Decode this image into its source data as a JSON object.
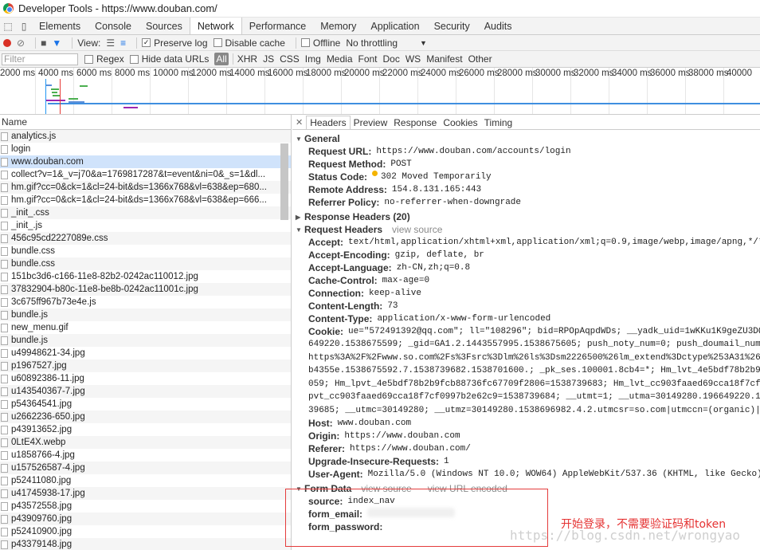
{
  "window": {
    "title": "Developer Tools - https://www.douban.com/"
  },
  "tabs": [
    "Elements",
    "Console",
    "Sources",
    "Network",
    "Performance",
    "Memory",
    "Application",
    "Security",
    "Audits"
  ],
  "toolbar": {
    "view_label": "View:",
    "preserve_log": "Preserve log",
    "disable_cache": "Disable cache",
    "offline": "Offline",
    "throttling": "No throttling"
  },
  "filterbar": {
    "placeholder": "Filter",
    "regex": "Regex",
    "hide_data_urls": "Hide data URLs",
    "types": [
      "All",
      "XHR",
      "JS",
      "CSS",
      "Img",
      "Media",
      "Font",
      "Doc",
      "WS",
      "Manifest",
      "Other"
    ]
  },
  "timeline": {
    "ticks": [
      "2000 ms",
      "4000 ms",
      "6000 ms",
      "8000 ms",
      "10000 ms",
      "12000 ms",
      "14000 ms",
      "16000 ms",
      "18000 ms",
      "20000 ms",
      "22000 ms",
      "24000 ms",
      "26000 ms",
      "28000 ms",
      "30000 ms",
      "32000 ms",
      "34000 ms",
      "36000 ms",
      "38000 ms",
      "40000"
    ]
  },
  "requests": {
    "header": "Name",
    "items": [
      "analytics.js",
      "login",
      "www.douban.com",
      "collect?v=1&_v=j70&a=1769817287&t=event&ni=0&_s=1&dl...",
      "hm.gif?cc=0&ck=1&cl=24-bit&ds=1366x768&vl=638&ep=680...",
      "hm.gif?cc=0&ck=1&cl=24-bit&ds=1366x768&vl=638&ep=666...",
      "_init_.css",
      "_init_.js",
      "456c95cd2227089e.css",
      "bundle.css",
      "bundle.css",
      "151bc3d6-c166-11e8-82b2-0242ac110012.jpg",
      "37832904-b80c-11e8-be8b-0242ac11001c.jpg",
      "3c675ff967b73e4e.js",
      "bundle.js",
      "new_menu.gif",
      "bundle.js",
      "u49948621-34.jpg",
      "p1967527.jpg",
      "u60892386-11.jpg",
      "u143540367-7.jpg",
      "p54364541.jpg",
      "u2662236-650.jpg",
      "p43913652.jpg",
      "0LtE4X.webp",
      "u1858766-4.jpg",
      "u157526587-4.jpg",
      "p52411080.jpg",
      "u41745938-17.jpg",
      "p43572558.jpg",
      "p43909760.jpg",
      "p52410900.jpg",
      "p43379148.jpg"
    ]
  },
  "detail": {
    "tabs": [
      "Headers",
      "Preview",
      "Response",
      "Cookies",
      "Timing"
    ],
    "general": {
      "title": "General",
      "items": [
        {
          "k": "Request URL:",
          "v": "https://www.douban.com/accounts/login"
        },
        {
          "k": "Request Method:",
          "v": "POST"
        },
        {
          "k": "Status Code:",
          "v": "302 Moved Temporarily"
        },
        {
          "k": "Remote Address:",
          "v": "154.8.131.165:443"
        },
        {
          "k": "Referrer Policy:",
          "v": "no-referrer-when-downgrade"
        }
      ]
    },
    "response_headers": {
      "title": "Response Headers (20)"
    },
    "request_headers": {
      "title": "Request Headers",
      "view_source": "view source",
      "items": [
        {
          "k": "Accept:",
          "v": "text/html,application/xhtml+xml,application/xml;q=0.9,image/webp,image/apng,*/*"
        },
        {
          "k": "Accept-Encoding:",
          "v": "gzip, deflate, br"
        },
        {
          "k": "Accept-Language:",
          "v": "zh-CN,zh;q=0.8"
        },
        {
          "k": "Cache-Control:",
          "v": "max-age=0"
        },
        {
          "k": "Connection:",
          "v": "keep-alive"
        },
        {
          "k": "Content-Length:",
          "v": "73"
        },
        {
          "k": "Content-Type:",
          "v": "application/x-www-form-urlencoded"
        }
      ],
      "cookie_key": "Cookie:",
      "cookie_lines": [
        "ue=\"572491392@qq.com\"; ll=\"108296\"; bid=RPOpAqpdWDs; __yadk_uid=1wKKu1K9geZU3DQ",
        "649220.1538675599; _gid=GA1.2.1443557995.1538675605; push_noty_num=0; push_doumail_num",
        "https%3A%2F%2Fwww.so.com%2Fs%3Fsrc%3Dlm%26ls%3Dsm2226500%26lm_extend%3Dctype%253A31%26",
        "b4355e.1538675592.7.1538739682.1538701600.; _pk_ses.100001.8cb4=*; Hm_lvt_4e5bdf78b2b9",
        "059; Hm_lpvt_4e5bdf78b2b9fcb88736fc67709f2806=1538739683; Hm_lvt_cc903faaed69cca18f7cf",
        "pvt_cc903faaed69cca18f7cf0997b2e62c9=1538739684; __utmt=1; __utma=30149280.196649220.1",
        "39685; __utmc=30149280; __utmz=30149280.1538696982.4.2.utmcsr=so.com|utmccn=(organic)|"
      ],
      "items2": [
        {
          "k": "Host:",
          "v": "www.douban.com"
        },
        {
          "k": "Origin:",
          "v": "https://www.douban.com"
        },
        {
          "k": "Referer:",
          "v": "https://www.douban.com/"
        },
        {
          "k": "Upgrade-Insecure-Requests:",
          "v": "1"
        },
        {
          "k": "User-Agent:",
          "v": "Mozilla/5.0 (Windows NT 10.0; WOW64) AppleWebKit/537.36 (KHTML, like Gecko)"
        }
      ]
    },
    "form_data": {
      "title": "Form Data",
      "view_source": "view source",
      "view_url_encoded": "view URL encoded",
      "source_k": "source:",
      "source_v": "index_nav",
      "email_k": "form_email:",
      "password_k": "form_password:"
    }
  },
  "annotation": "开始登录，不需要验证码和token",
  "watermark": "https://blog.csdn.net/wrongyao"
}
